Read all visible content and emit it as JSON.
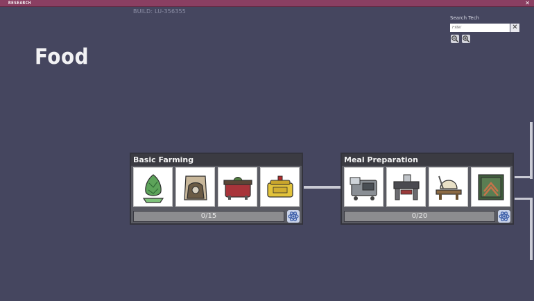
{
  "window": {
    "title": "RESEARCH",
    "close_label": "✕"
  },
  "build": "BUILD: LU-356355",
  "category": "Food",
  "search": {
    "label": "Search Tech",
    "placeholder": "Filter",
    "clear_label": "✕"
  },
  "zoom": {
    "out_icon": "zoom-out-icon",
    "in_icon": "zoom-in-icon"
  },
  "cards": [
    {
      "title": "Basic Farming",
      "progress": "0/15",
      "unlocks": [
        "plant-icon",
        "compost-sack-icon",
        "planter-box-icon",
        "ration-box-icon"
      ]
    },
    {
      "title": "Meal Preparation",
      "progress": "0/20",
      "unlocks": [
        "microbe-musher-icon",
        "grill-icon",
        "sink-icon",
        "farm-tile-icon"
      ]
    }
  ],
  "colors": {
    "background": "#45465f",
    "titlebar": "#8a3f62",
    "card": "#5a5b63",
    "card_header": "#3b3b42"
  }
}
